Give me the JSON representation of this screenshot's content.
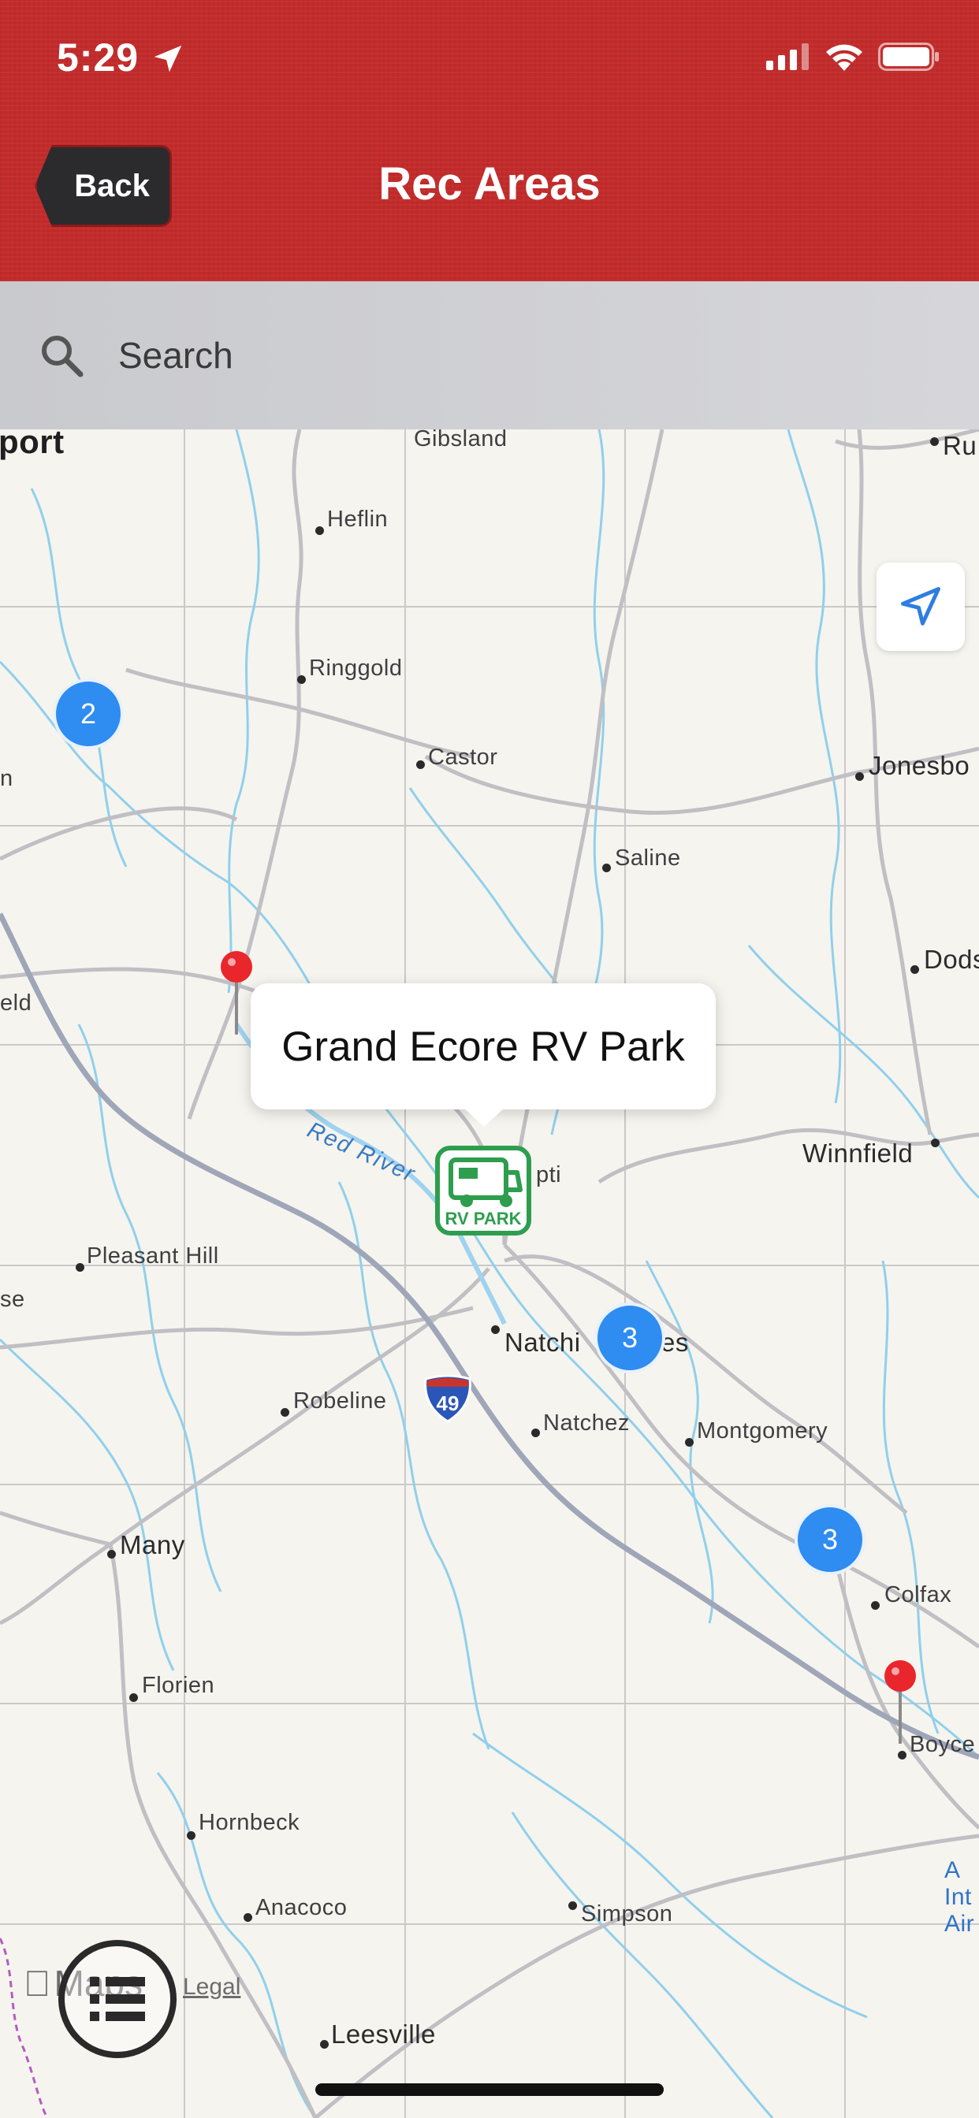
{
  "status_bar": {
    "time": "5:29",
    "icons": [
      "location-arrow-icon",
      "cellular-signal-icon",
      "wifi-icon",
      "battery-icon"
    ]
  },
  "header": {
    "back_label": "Back",
    "title": "Rec Areas",
    "bg_color": "#c32b2b"
  },
  "search": {
    "placeholder": "Search"
  },
  "map": {
    "places": {
      "port": "port",
      "gibsland": "Gibsland",
      "ru": "Ru",
      "heflin": "Heflin",
      "ringgold": "Ringgold",
      "n": "n",
      "castor": "Castor",
      "jonesboro": "Jonesbo",
      "saline": "Saline",
      "dods": "Dods",
      "eld": "eld",
      "winnfield": "Winnfield",
      "pti": "pti",
      "pleasant_hill": "Pleasant Hill",
      "se": "se",
      "natchitoches_a": "Natchi",
      "natchitoches_b": "es",
      "robeline": "Robeline",
      "natchez": "Natchez",
      "montgomery": "Montgomery",
      "many": "Many",
      "colfax": "Colfax",
      "florien": "Florien",
      "boyce": "Boyce",
      "hornbeck": "Hornbeck",
      "anacoco": "Anacoco",
      "simpson": "Simpson",
      "airport": "A\nInt\nAir",
      "leesville": "Leesville"
    },
    "river_label": "Red River",
    "interstate": "49",
    "clusters": {
      "top_left": "2",
      "natchitoches": "3",
      "colfax": "3"
    },
    "callout": "Grand Ecore RV Park",
    "rv_marker": {
      "line1": "RV PARK"
    },
    "attribution": {
      "maps": "Maps",
      "legal": "Legal"
    }
  }
}
